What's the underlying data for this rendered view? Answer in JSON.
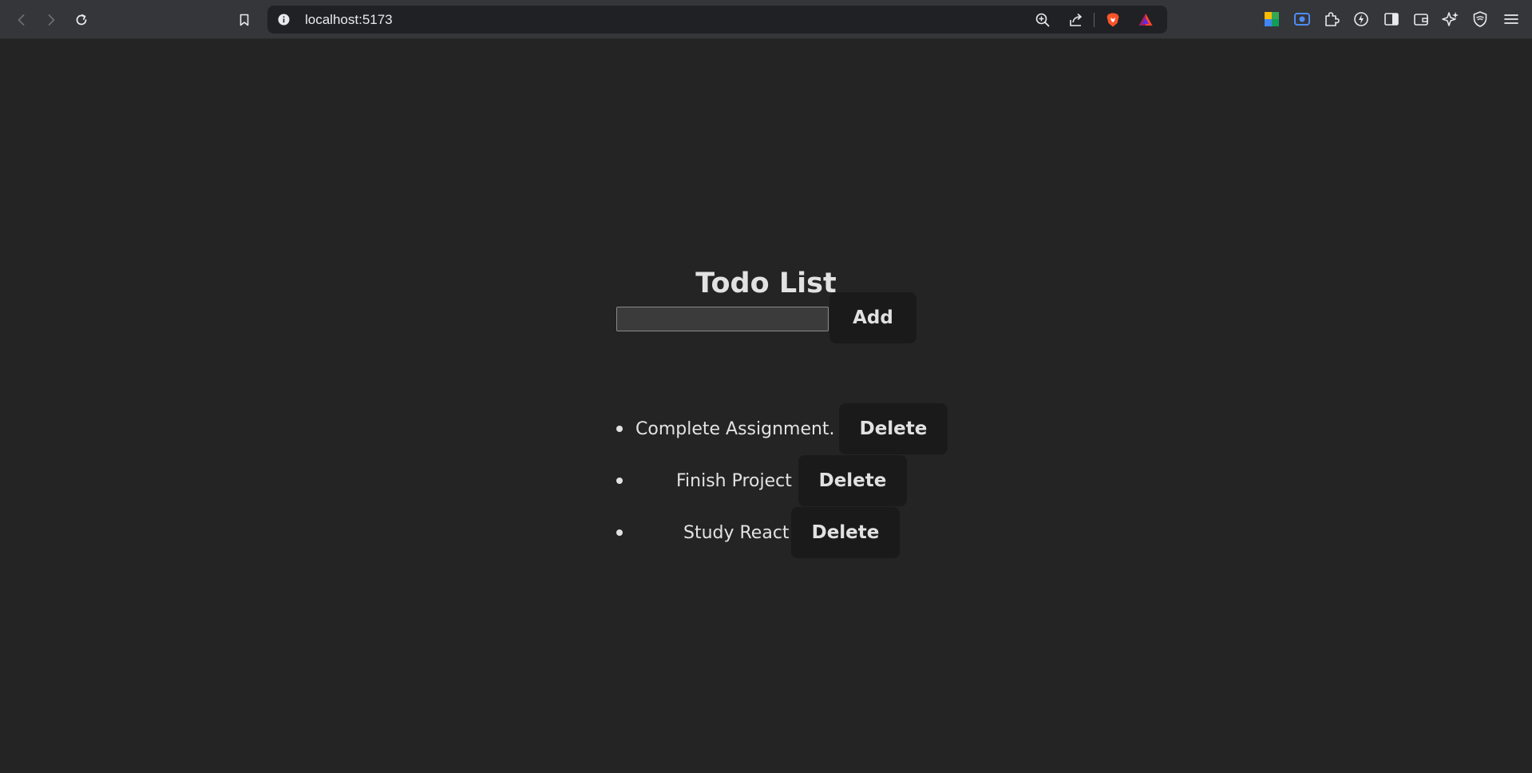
{
  "browser": {
    "url": "localhost:5173",
    "nav_icons": [
      "back-icon",
      "forward-icon",
      "reload-icon",
      "bookmark-icon"
    ],
    "address_icons": [
      "site-info-icon",
      "zoom-icon",
      "share-icon",
      "brave-shields-icon",
      "brave-rewards-icon"
    ],
    "extension_icons": [
      "sheets-extension-icon",
      "screen-capture-extension-icon",
      "extensions-puzzle-icon",
      "leo-extension-icon",
      "sidebar-icon",
      "wallet-icon",
      "leo-ai-icon",
      "vpn-shield-icon",
      "menu-icon"
    ]
  },
  "app": {
    "title": "Todo List",
    "input": {
      "value": "",
      "placeholder": ""
    },
    "add_label": "Add",
    "todos": [
      {
        "text": "Complete Assignment.",
        "delete_label": "Delete"
      },
      {
        "text": "Finish Project",
        "delete_label": "Delete"
      },
      {
        "text": "Study React",
        "delete_label": "Delete"
      }
    ]
  },
  "colors": {
    "page_background": "#242424",
    "toolbar_background": "#35363a",
    "button_background": "#1a1a1a",
    "text": "#dedede",
    "brave_orange": "#fb542b"
  }
}
